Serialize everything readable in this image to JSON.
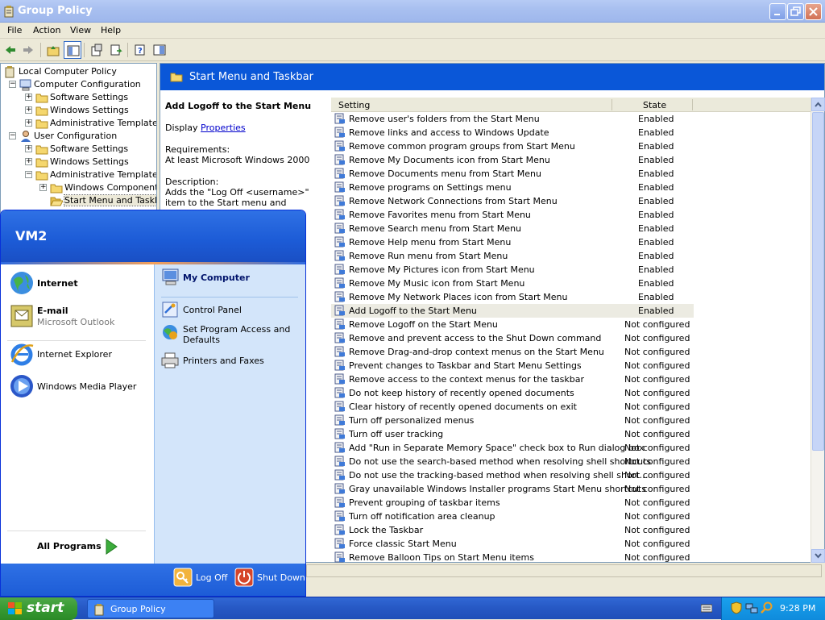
{
  "window": {
    "title": "Group Policy"
  },
  "menu": [
    "File",
    "Action",
    "View",
    "Help"
  ],
  "tree": {
    "items": [
      {
        "label": "Local Computer Policy",
        "icon": "policy-icon",
        "level": 0,
        "exp": ""
      },
      {
        "label": "Computer Configuration",
        "icon": "computer-icon",
        "level": 1,
        "exp": "−"
      },
      {
        "label": "Software Settings",
        "icon": "folder-icon",
        "level": 2,
        "exp": "+"
      },
      {
        "label": "Windows Settings",
        "icon": "folder-icon",
        "level": 2,
        "exp": "+"
      },
      {
        "label": "Administrative Templates",
        "icon": "folder-icon",
        "level": 2,
        "exp": "+"
      },
      {
        "label": "User Configuration",
        "icon": "user-icon",
        "level": 1,
        "exp": "−"
      },
      {
        "label": "Software Settings",
        "icon": "folder-icon",
        "level": 2,
        "exp": "+"
      },
      {
        "label": "Windows Settings",
        "icon": "folder-icon",
        "level": 2,
        "exp": "+"
      },
      {
        "label": "Administrative Templates",
        "icon": "folder-icon",
        "level": 2,
        "exp": "−"
      },
      {
        "label": "Windows Components",
        "icon": "folder-icon",
        "level": 3,
        "exp": "+"
      },
      {
        "label": "Start Menu and Taskbar",
        "icon": "folder-open-icon",
        "level": 3,
        "exp": "",
        "selected": true
      }
    ]
  },
  "panel": {
    "header": "Start Menu and Taskbar",
    "desc_title": "Add Logoff to the Start Menu",
    "display_label": "Display",
    "display_link": "Properties",
    "requirements_label": "Requirements:",
    "requirements": "At least Microsoft Windows 2000",
    "description_label": "Description:",
    "description": "Adds the \"Log Off <username>\" item to the Start menu and prevents users from"
  },
  "list": {
    "columns": [
      "Setting",
      "State"
    ],
    "rows": [
      {
        "setting": "Remove user's folders from the Start Menu",
        "state": "Enabled"
      },
      {
        "setting": "Remove links and access to Windows Update",
        "state": "Enabled"
      },
      {
        "setting": "Remove common program groups from Start Menu",
        "state": "Enabled"
      },
      {
        "setting": "Remove My Documents icon from Start Menu",
        "state": "Enabled"
      },
      {
        "setting": "Remove Documents menu from Start Menu",
        "state": "Enabled"
      },
      {
        "setting": "Remove programs on Settings menu",
        "state": "Enabled"
      },
      {
        "setting": "Remove Network Connections from Start Menu",
        "state": "Enabled"
      },
      {
        "setting": "Remove Favorites menu from Start Menu",
        "state": "Enabled"
      },
      {
        "setting": "Remove Search menu from Start Menu",
        "state": "Enabled"
      },
      {
        "setting": "Remove Help menu from Start Menu",
        "state": "Enabled"
      },
      {
        "setting": "Remove Run menu from Start Menu",
        "state": "Enabled"
      },
      {
        "setting": "Remove My Pictures icon from Start Menu",
        "state": "Enabled"
      },
      {
        "setting": "Remove My Music icon from Start Menu",
        "state": "Enabled"
      },
      {
        "setting": "Remove My Network Places icon from Start Menu",
        "state": "Enabled"
      },
      {
        "setting": "Add Logoff to the Start Menu",
        "state": "Enabled",
        "selected": true
      },
      {
        "setting": "Remove Logoff on the Start Menu",
        "state": "Not configured"
      },
      {
        "setting": "Remove and prevent access to the Shut Down command",
        "state": "Not configured"
      },
      {
        "setting": "Remove Drag-and-drop context menus on the Start Menu",
        "state": "Not configured"
      },
      {
        "setting": "Prevent changes to Taskbar and Start Menu Settings",
        "state": "Not configured"
      },
      {
        "setting": "Remove access to the context menus for the taskbar",
        "state": "Not configured"
      },
      {
        "setting": "Do not keep history of recently opened documents",
        "state": "Not configured"
      },
      {
        "setting": "Clear history of recently opened documents on exit",
        "state": "Not configured"
      },
      {
        "setting": "Turn off personalized menus",
        "state": "Not configured"
      },
      {
        "setting": "Turn off user tracking",
        "state": "Not configured"
      },
      {
        "setting": "Add \"Run in Separate Memory Space\" check box to Run dialog box",
        "state": "Not configured"
      },
      {
        "setting": "Do not use the search-based method when resolving shell shortcuts",
        "state": "Not configured"
      },
      {
        "setting": "Do not use the tracking-based method when resolving shell short…",
        "state": "Not configured"
      },
      {
        "setting": "Gray unavailable Windows Installer programs Start Menu shortcuts",
        "state": "Not configured"
      },
      {
        "setting": "Prevent grouping of taskbar items",
        "state": "Not configured"
      },
      {
        "setting": "Turn off notification area cleanup",
        "state": "Not configured"
      },
      {
        "setting": "Lock the Taskbar",
        "state": "Not configured"
      },
      {
        "setting": "Force classic Start Menu",
        "state": "Not configured"
      },
      {
        "setting": "Remove Balloon Tips on Start Menu items",
        "state": "Not configured"
      }
    ]
  },
  "start_menu": {
    "user": "VM2",
    "left": [
      {
        "label": "Internet",
        "bold": true,
        "icon": "internet-globe-icon"
      },
      {
        "label": "E-mail",
        "sub": "Microsoft Outlook",
        "bold": true,
        "icon": "outlook-icon"
      },
      {
        "label": "Internet Explorer",
        "icon": "ie-icon"
      },
      {
        "label": "Windows Media Player",
        "icon": "media-player-icon"
      }
    ],
    "all_programs": "All Programs",
    "right": [
      {
        "label": "My Computer",
        "bold": true,
        "icon": "my-computer-icon"
      },
      {
        "label": "Control Panel",
        "icon": "control-panel-icon"
      },
      {
        "label": "Set Program Access and\nDefaults",
        "icon": "program-access-icon"
      },
      {
        "label": "Printers and Faxes",
        "icon": "printer-icon"
      }
    ],
    "log_off": "Log Off",
    "shut_down": "Shut Down"
  },
  "taskbar": {
    "start": "start",
    "task": "Group Policy",
    "clock": "9:28 PM"
  },
  "colors": {
    "header_blue": "#0a57d8",
    "taskbar_blue": "#2658c4",
    "start_green": "#379a33"
  }
}
